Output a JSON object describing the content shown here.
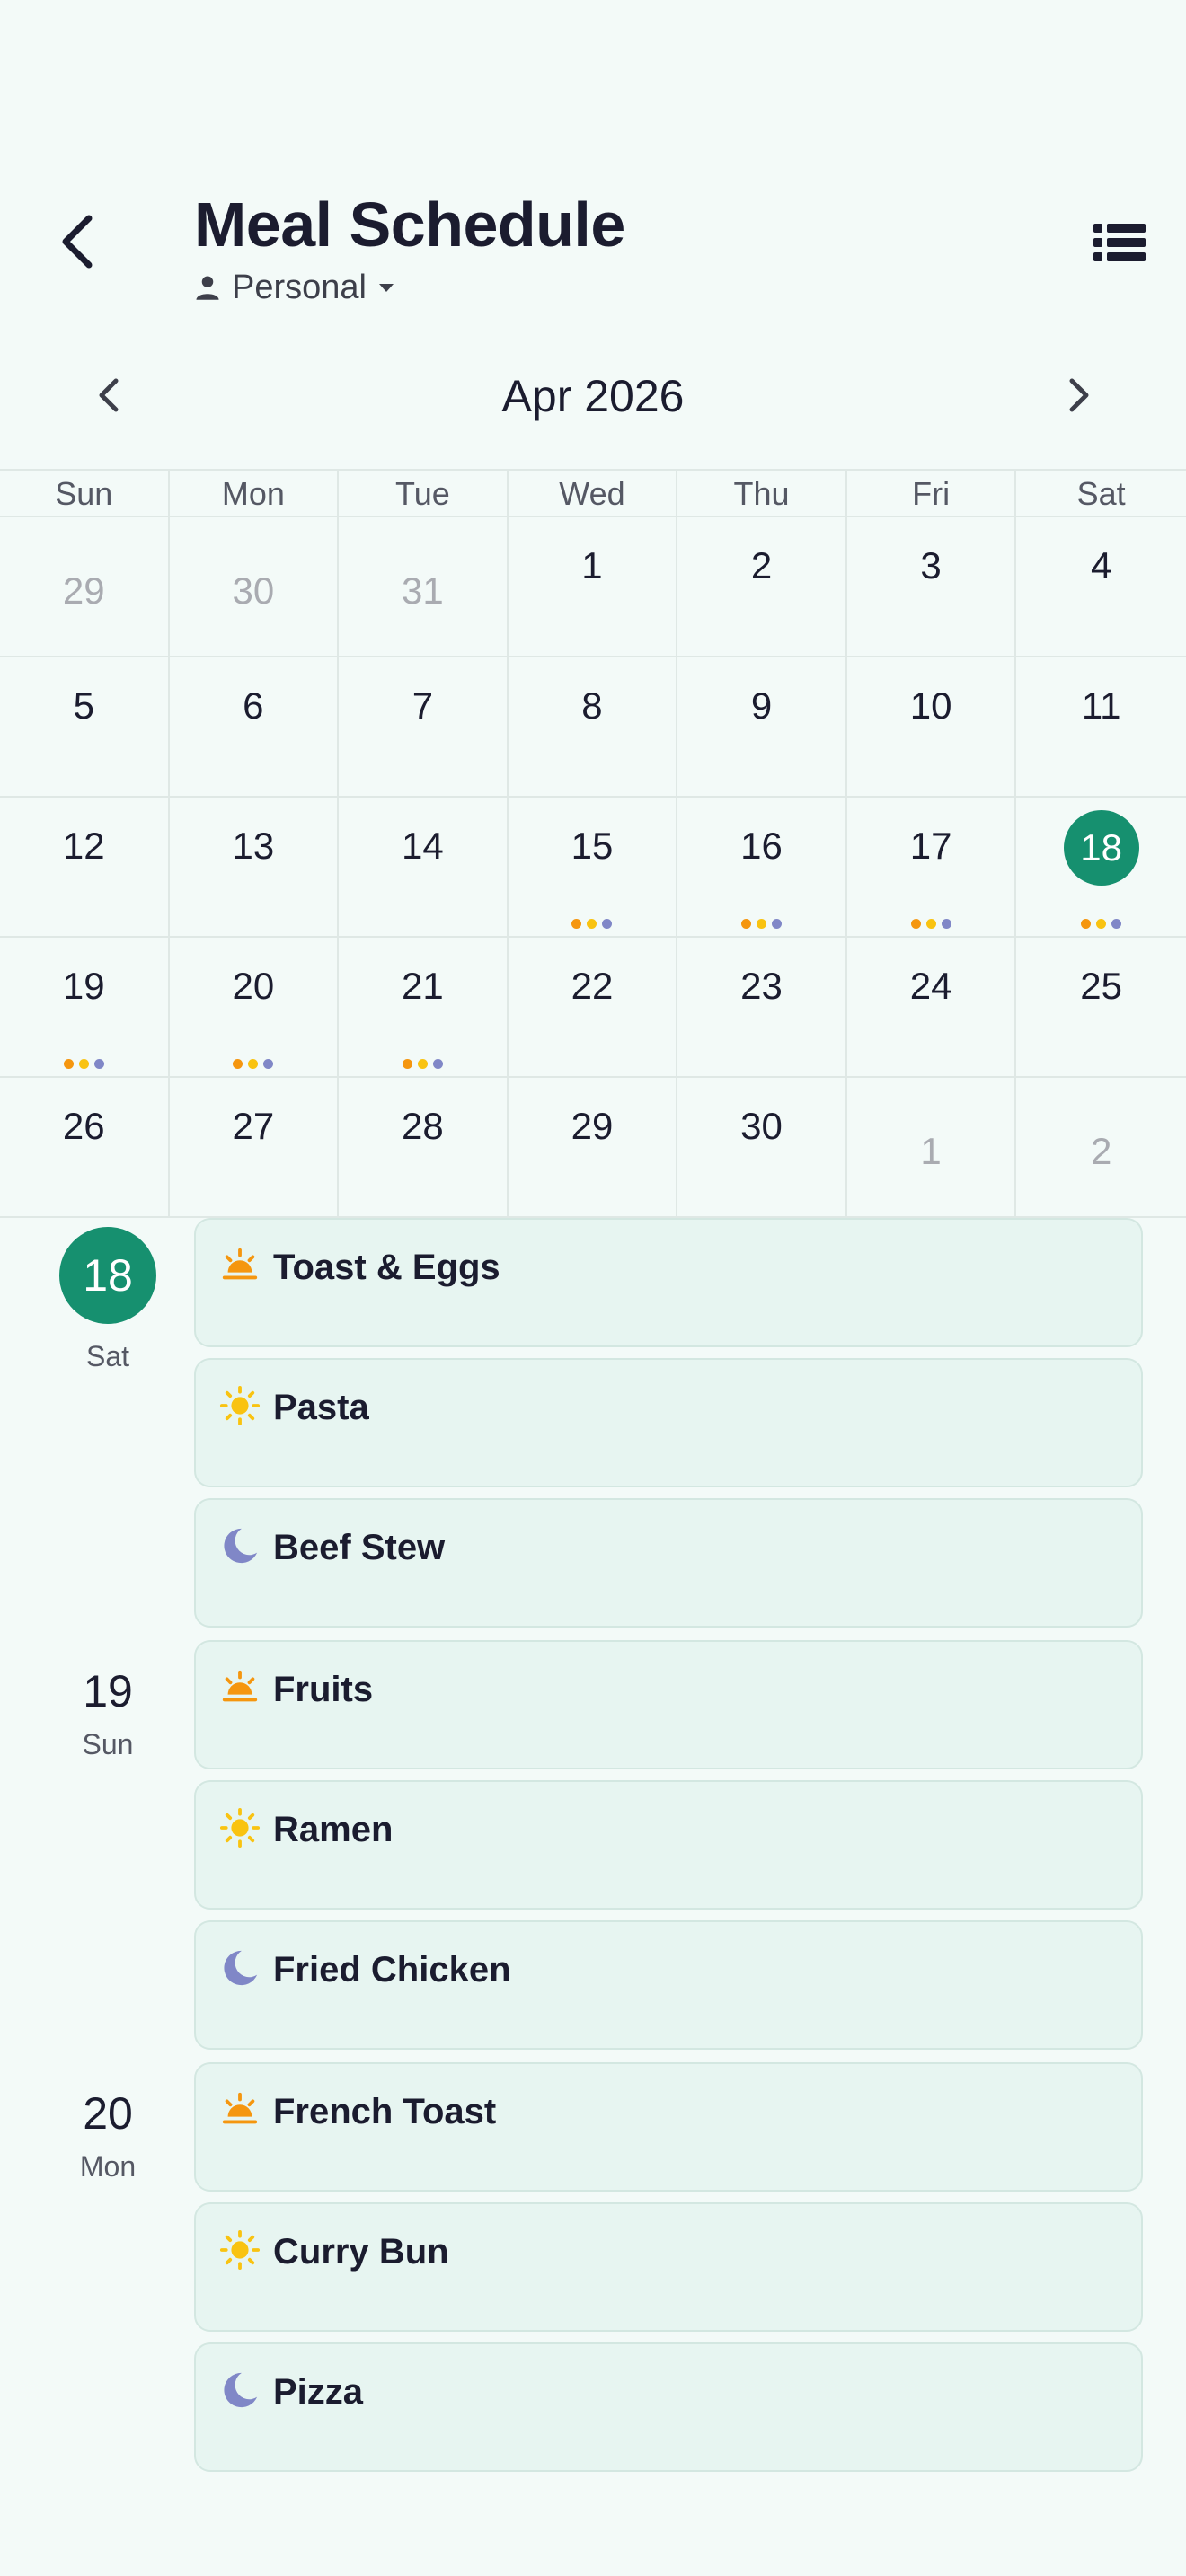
{
  "header": {
    "title": "Meal Schedule",
    "scope_label": "Personal"
  },
  "calendar": {
    "month_label": "Apr 2026",
    "weekdays": [
      "Sun",
      "Mon",
      "Tue",
      "Wed",
      "Thu",
      "Fri",
      "Sat"
    ],
    "weeks": [
      [
        {
          "d": "29",
          "outside": true
        },
        {
          "d": "30",
          "outside": true
        },
        {
          "d": "31",
          "outside": true
        },
        {
          "d": "1"
        },
        {
          "d": "2"
        },
        {
          "d": "3"
        },
        {
          "d": "4"
        }
      ],
      [
        {
          "d": "5"
        },
        {
          "d": "6"
        },
        {
          "d": "7"
        },
        {
          "d": "8"
        },
        {
          "d": "9"
        },
        {
          "d": "10"
        },
        {
          "d": "11"
        }
      ],
      [
        {
          "d": "12"
        },
        {
          "d": "13"
        },
        {
          "d": "14"
        },
        {
          "d": "15",
          "meals": true
        },
        {
          "d": "16",
          "meals": true
        },
        {
          "d": "17",
          "meals": true
        },
        {
          "d": "18",
          "meals": true,
          "selected": true
        }
      ],
      [
        {
          "d": "19",
          "meals": true
        },
        {
          "d": "20",
          "meals": true
        },
        {
          "d": "21",
          "meals": true
        },
        {
          "d": "22"
        },
        {
          "d": "23"
        },
        {
          "d": "24"
        },
        {
          "d": "25"
        }
      ],
      [
        {
          "d": "26"
        },
        {
          "d": "27"
        },
        {
          "d": "28"
        },
        {
          "d": "29"
        },
        {
          "d": "30"
        },
        {
          "d": "1",
          "outside": true
        },
        {
          "d": "2",
          "outside": true
        }
      ]
    ]
  },
  "colors": {
    "accent": "#16906f",
    "breakfast": "#f5960f",
    "lunch": "#f9c311",
    "dinner": "#8087c7",
    "card_bg": "#e7f5f1"
  },
  "agenda": [
    {
      "day": "18",
      "dow": "Sat",
      "selected": true,
      "meals": [
        {
          "type": "breakfast",
          "icon": "sunrise-icon",
          "name": "Toast & Eggs"
        },
        {
          "type": "lunch",
          "icon": "sun-icon",
          "name": "Pasta"
        },
        {
          "type": "dinner",
          "icon": "moon-icon",
          "name": "Beef Stew"
        }
      ]
    },
    {
      "day": "19",
      "dow": "Sun",
      "meals": [
        {
          "type": "breakfast",
          "icon": "sunrise-icon",
          "name": "Fruits"
        },
        {
          "type": "lunch",
          "icon": "sun-icon",
          "name": "Ramen"
        },
        {
          "type": "dinner",
          "icon": "moon-icon",
          "name": "Fried Chicken"
        }
      ]
    },
    {
      "day": "20",
      "dow": "Mon",
      "meals": [
        {
          "type": "breakfast",
          "icon": "sunrise-icon",
          "name": "French Toast"
        },
        {
          "type": "lunch",
          "icon": "sun-icon",
          "name": "Curry Bun"
        },
        {
          "type": "dinner",
          "icon": "moon-icon",
          "name": "Pizza"
        }
      ]
    }
  ]
}
